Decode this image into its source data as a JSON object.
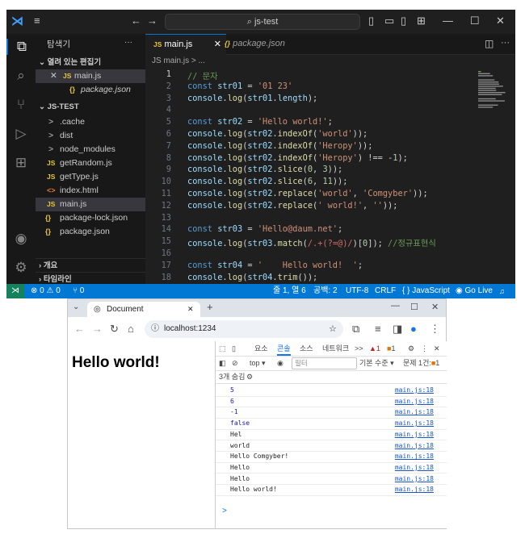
{
  "vscode": {
    "title": "js-test",
    "sidebar": {
      "header": "탐색기",
      "more": "···",
      "open_editors": "열려 있는 편집기",
      "open_items": [
        {
          "icon": "JS",
          "label": "main.js",
          "close": "✕"
        },
        {
          "icon": "{}",
          "label": "package.json"
        }
      ],
      "folder": "JS-TEST",
      "tree": [
        {
          "icon": ">",
          "label": ".cache"
        },
        {
          "icon": ">",
          "label": "dist"
        },
        {
          "icon": ">",
          "label": "node_modules"
        },
        {
          "icon": "JS",
          "label": "getRandom.js"
        },
        {
          "icon": "JS",
          "label": "getType.js"
        },
        {
          "icon": "<>",
          "label": "index.html"
        },
        {
          "icon": "JS",
          "label": "main.js"
        },
        {
          "icon": "{}",
          "label": "package-lock.json"
        },
        {
          "icon": "{}",
          "label": "package.json"
        }
      ],
      "outline": "개요",
      "timeline": "타임라인"
    },
    "tabs": [
      {
        "icon": "JS",
        "label": "main.js",
        "close": "✕"
      },
      {
        "icon": "{}",
        "label": "package.json"
      }
    ],
    "breadcrumb": "JS main.js > ...",
    "line_numbers": [
      "1",
      "2",
      "3",
      "4",
      "5",
      "6",
      "7",
      "8",
      "9",
      "10",
      "11",
      "12",
      "13",
      "14",
      "15",
      "16",
      "17",
      "18"
    ],
    "status": {
      "errors": "⊗ 0 ⚠ 0",
      "ports": "⑂ 0",
      "position": "줄 1, 열 6",
      "spaces": "공백: 2",
      "encoding": "UTF-8",
      "eol": "CRLF",
      "language": "{ } JavaScript",
      "golive": "Go Live",
      "bell": "🔔"
    }
  },
  "chrome": {
    "tab_title": "Document",
    "tab_close": "✕",
    "new_tab": "+",
    "url": "localhost:1234",
    "page_heading": "Hello world!",
    "devtools": {
      "tabs": [
        "요소",
        "콘솔",
        "소스",
        "네트워크",
        ">>"
      ],
      "warn_count": "▲1",
      "err_count": "1",
      "context": "top ▾",
      "filter_placeholder": "필터",
      "level": "기본 수준 ▾",
      "issues": "문제 1건:",
      "issues_count": "1",
      "hidden": "3개 숨김",
      "logs": [
        {
          "value": "5",
          "source": "main.js:18",
          "blue": true
        },
        {
          "value": "6",
          "source": "main.js:18",
          "blue": true
        },
        {
          "value": "-1",
          "source": "main.js:18",
          "blue": true
        },
        {
          "value": "false",
          "source": "main.js:18",
          "blue": true
        },
        {
          "value": "Hel",
          "source": "main.js:18",
          "blue": false
        },
        {
          "value": "world",
          "source": "main.js:18",
          "blue": false
        },
        {
          "value": "Hello Comgyber!",
          "source": "main.js:18",
          "blue": false
        },
        {
          "value": "Hello",
          "source": "main.js:18",
          "blue": false
        },
        {
          "value": "Hello",
          "source": "main.js:18",
          "blue": false
        },
        {
          "value": "Hello world!",
          "source": "main.js:18",
          "blue": false
        }
      ],
      "prompt": ">"
    }
  },
  "code_lines": [
    "// 문자",
    "const str01 = '01 23'",
    "console.log(str01.length);",
    "",
    "const str02 = 'Hello world!';",
    "console.log(str02.indexOf('world'));",
    "console.log(str02.indexOf('Heropy'));",
    "console.log(str02.indexOf('Heropy') !== -1);",
    "console.log(str02.slice(0, 3));",
    "console.log(str02.slice(6, 11));",
    "console.log(str02.replace('world', 'Comgyber'));",
    "console.log(str02.replace(' world!', ''));",
    "",
    "const str03 = 'Hello@daum.net';",
    "console.log(str03.match(/.+(?=@)/)[0]); //정규표현식",
    "",
    "const str04 = '    Hello world!  ';",
    "console.log(str04.trim());"
  ],
  "colors": {
    "accent": "#0078d4",
    "js_badge": "#e8c53a",
    "keyword": "#569cd6",
    "string": "#ce9178",
    "comment": "#6a9955"
  }
}
